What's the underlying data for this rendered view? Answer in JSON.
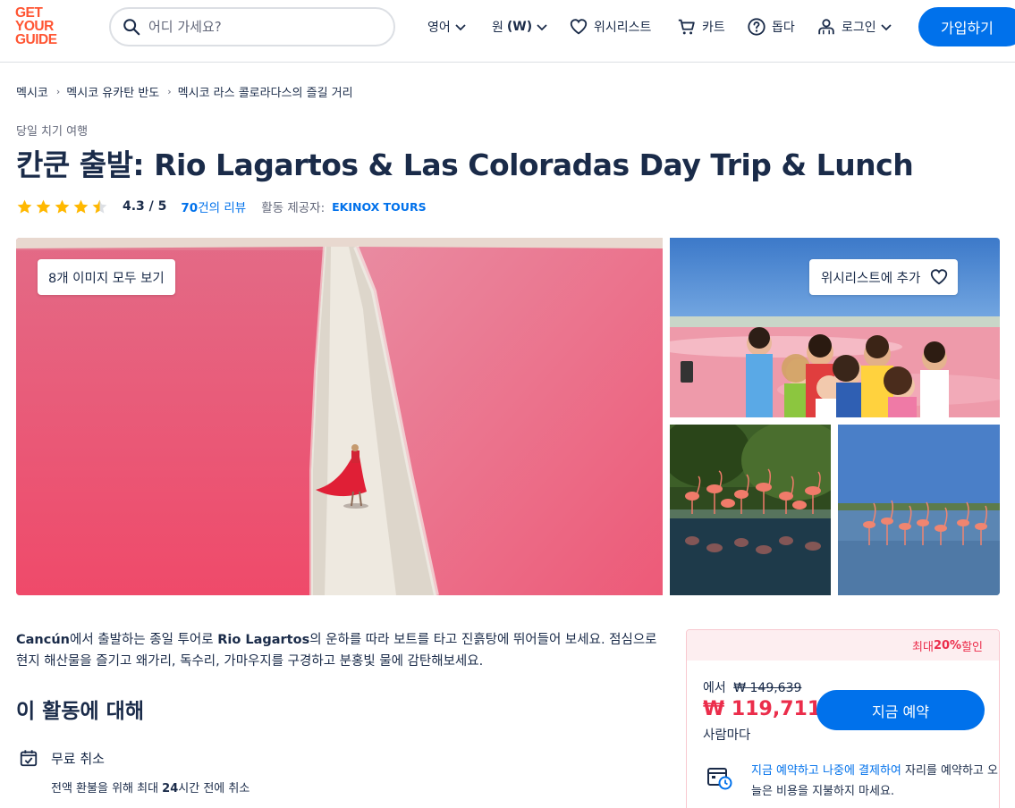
{
  "header": {
    "logo": [
      "GET",
      "YOUR",
      "GUIDE"
    ],
    "search_placeholder": "어디 가세요?",
    "language": "영어",
    "currency_prefix": "원",
    "currency_code": "(W)",
    "wishlist": "위시리스트",
    "cart": "카트",
    "help": "돕다",
    "login": "로그인",
    "signup": "가입하기"
  },
  "breadcrumb": [
    "멕시코",
    "멕시코 유카탄 반도",
    "멕시코 라스 콜로라다스의 즐길 거리"
  ],
  "category": "당일 치기 여행",
  "title": "칸쿤 출발: Rio Lagartos & Las Coloradas Day Trip & Lunch",
  "rating": {
    "value": "4.3 / 5",
    "stars": 4.3,
    "reviews_count": "70",
    "reviews_suffix": "건의 리뷰",
    "provider_label": "활동 제공자:",
    "provider": "EKINOX TOURS"
  },
  "gallery": {
    "view_all": "8개 이미지 모두 보기",
    "add_wishlist": "위시리스트에 추가"
  },
  "description": {
    "part1": "Cancún",
    "part2": "에서 출발하는 종일 투어로 ",
    "part3": "Rio Lagartos",
    "part4": "의 운하를 따라 보트를 타고 진흙탕에 뛰어들어 보세요. 점심으로 현지 해산물을 즐기고 왜가리, 독수리, 가마우지를 구경하고 분홍빛 물에 감탄해보세요."
  },
  "about": {
    "title": "이 활동에 대해",
    "free_cancel": "무료 취소",
    "free_cancel_sub_a": "전액 환불을 위해 최대 ",
    "free_cancel_sub_b": "24",
    "free_cancel_sub_c": "시간 전에 취소"
  },
  "booking": {
    "discount_prefix": "최대 ",
    "discount_value": "20%",
    "discount_suffix": " 할인",
    "from_label": "에서",
    "original_price": "₩ 149,639",
    "price": "₩ 119,711",
    "per_person": "사람마다",
    "book_now": "지금 예약",
    "later_link": "지금 예약하고 나중에 결제하여",
    "later_text": " 자리를 예약하고 오늘은 비용을 지불하지 마세요."
  },
  "colors": {
    "brand": "#ff5533",
    "accent": "#0071eb",
    "sale": "#eb2d4b",
    "star": "#ffb800"
  }
}
